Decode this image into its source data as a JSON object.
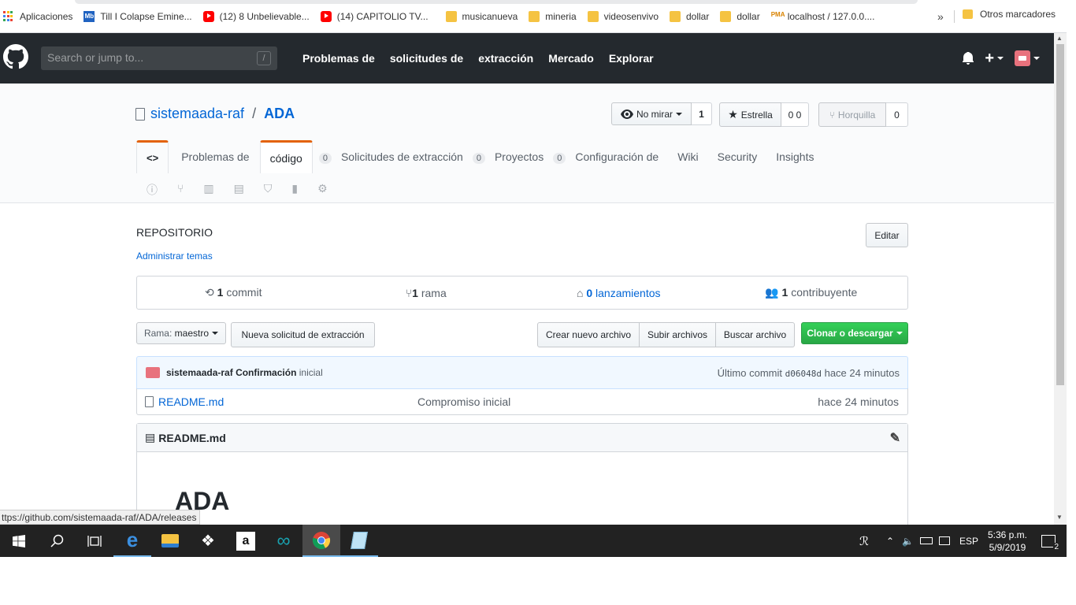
{
  "bookmarks": {
    "items": [
      {
        "label": "Aplicaciones",
        "icon": "apps-grid-icon"
      },
      {
        "label": "Till I Colapse Emine...",
        "icon": "musicbrainz-icon"
      },
      {
        "label": "(12) 8 Unbelievable...",
        "icon": "youtube-icon"
      },
      {
        "label": "(14) CAPITOLIO TV...",
        "icon": "youtube-icon"
      },
      {
        "label": "musicanueva",
        "icon": "folder-icon"
      },
      {
        "label": "mineria",
        "icon": "folder-icon"
      },
      {
        "label": "videosenvivo",
        "icon": "folder-icon"
      },
      {
        "label": "dollar",
        "icon": "folder-icon"
      },
      {
        "label": "dollar",
        "icon": "folder-icon"
      },
      {
        "label": "localhost / 127.0.0....",
        "icon": "phpmyadmin-icon"
      }
    ],
    "more": "»",
    "other": "Otros marcadores",
    "mb_text": "Mb",
    "pma_text": "PMA"
  },
  "header": {
    "search_placeholder": "Search or jump to...",
    "search_key": "/",
    "nav": [
      "Problemas de",
      "solicitudes de",
      "extracción",
      "Mercado",
      "Explorar"
    ],
    "plus": "+"
  },
  "repo": {
    "owner": "sistemaada-raf",
    "separator": "/",
    "name": "ADA",
    "watch_label": "No mirar",
    "watch_count": "1",
    "star_label": "Estrella",
    "star_count": "0 0",
    "fork_label": "Horquilla",
    "fork_count": "0"
  },
  "tabs": {
    "code_icon": "<>",
    "items": [
      {
        "label": "Problemas de",
        "badge": null
      },
      {
        "label": "código",
        "badge": "0",
        "selected": true
      },
      {
        "label": "Solicitudes de extracción",
        "badge": "0"
      },
      {
        "label": "Proyectos",
        "badge": "0"
      },
      {
        "label": "Configuración de",
        "badge": null
      },
      {
        "label": "Wiki",
        "badge": null
      },
      {
        "label": "Security",
        "badge": null
      },
      {
        "label": "Insights",
        "badge": null
      }
    ]
  },
  "about": {
    "label": "REPOSITORIO",
    "manage_topics": "Administrar temas",
    "edit": "Editar"
  },
  "summary": {
    "commits_num": "1",
    "commits_label": "commit",
    "branches_num": "1",
    "branches_label": "rama",
    "releases_num": "0",
    "releases_label": "lanzamientos",
    "contrib_num": "1",
    "contrib_label": "contribuyente"
  },
  "file_nav": {
    "branch_prefix": "Rama:",
    "branch": "maestro",
    "new_pr": "Nueva solicitud de extracción",
    "create_file": "Crear nuevo archivo",
    "upload": "Subir archivos",
    "find": "Buscar archivo",
    "clone": "Clonar o descargar"
  },
  "commit": {
    "author": "sistemaada-raf",
    "message": "Confirmación",
    "message_suffix": "inicial",
    "latest_label": "Último commit",
    "sha": "d06048d",
    "age": "hace 24 minutos"
  },
  "files": [
    {
      "name": "README.md",
      "message": "Compromiso inicial",
      "age": "hace 24 minutos"
    }
  ],
  "readme": {
    "header": "README.md",
    "title": "ADA"
  },
  "status_url": "ttps://github.com/sistemaada-raf/ADA/releases",
  "taskbar": {
    "lang": "ESP",
    "time": "5:36 p.m.",
    "date": "5/9/2019",
    "notif_count": "2",
    "amazon": "a"
  }
}
